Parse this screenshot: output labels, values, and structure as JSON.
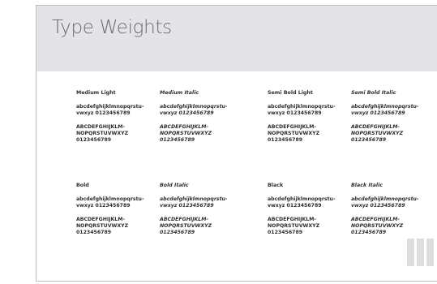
{
  "page": {
    "title": "Type Weights"
  },
  "samples": [
    {
      "label": "Medium Light",
      "italic": false,
      "lower": "abcdefghijklmnopqrstu-\nvwxyz 0123456789",
      "upper": "ABCDEFGHIJKLM-\nNOPQRSTUVWXYZ\n0123456789"
    },
    {
      "label": "Medium Italic",
      "italic": true,
      "lower": "abcdefghijklmnopqrstu-\nvwxyz 0123456789",
      "upper": "ABCDEFGHIJKLM-\nNOPQRSTUVWXYZ\n0123456789"
    },
    {
      "label": "Semi Bold Light",
      "italic": false,
      "lower": "abcdefghijklmnopqrstu-\nvwxyz 0123456789",
      "upper": "ABCDEFGHIJKLM-\nNOPQRSTUVWXYZ\n0123456789"
    },
    {
      "label": "Semi Bold Italic",
      "italic": true,
      "lower": "abcdefghijklmnopqrstu-\nvwxyz 0123456789",
      "upper": "ABCDEFGHIJKLM-\nNOPQRSTUVWXYZ\n0123456789"
    },
    {
      "label": "Bold",
      "italic": false,
      "lower": "abcdefghijklmnopqrstu-\nvwxyz 0123456789",
      "upper": "ABCDEFGHIJKLM-\nNOPQRSTUVWXYZ\n0123456789"
    },
    {
      "label": "Bold Italic",
      "italic": true,
      "lower": "abcdefghijklmnopqrstu-\nvwxyz 0123456789",
      "upper": "ABCDEFGHIJKLM-\nNOPQRSTUVWXYZ\n0123456789"
    },
    {
      "label": "Black",
      "italic": false,
      "lower": "abcdefghijklmnopqrstu-\nvwxyz 0123456789",
      "upper": "ABCDEFGHIJKLM-\nNOPQRSTUVWXYZ\n0123456789"
    },
    {
      "label": "Black Italic",
      "italic": true,
      "lower": "abcdefghijklmnopqrstu-\nvwxyz 0123456789",
      "upper": "ABCDEFGHIJKLM-\nNOPQRSTUVWXYZ\n0123456789"
    }
  ],
  "colors": {
    "header_bg": "#e4e4e8",
    "title": "#6b6b6b",
    "text": "#2e2e2e",
    "border": "#bfbfbf",
    "bars": "#dedede"
  }
}
